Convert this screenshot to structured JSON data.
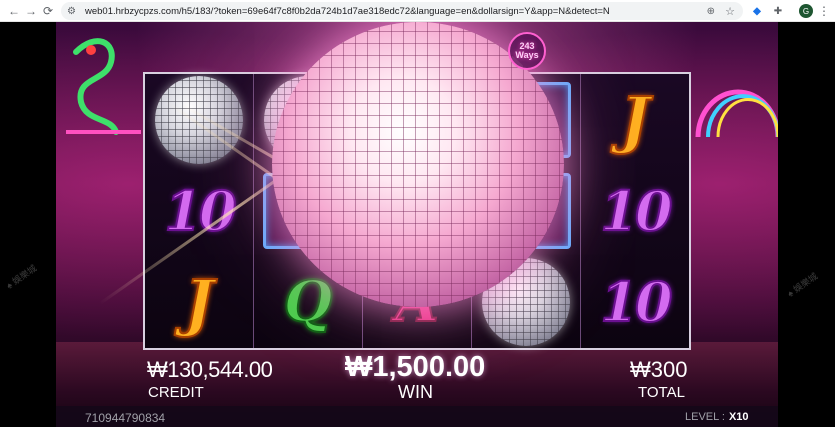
{
  "browser": {
    "url": "web01.hrbzycpzs.com/h5/183/?token=69e64f7c8f0b2da724b1d7ae318edc72&language=en&dollarsign=Y&app=N&detect=N",
    "avatar_letter": "G"
  },
  "game": {
    "ways_number": "243",
    "ways_label": "Ways",
    "reels": [
      [
        "ball",
        "10",
        "J"
      ],
      [
        "ball",
        "frame",
        "Q"
      ],
      [
        "ball",
        "frame",
        "A"
      ],
      [
        "frame",
        "frame",
        "ball"
      ],
      [
        "J",
        "10",
        "10"
      ]
    ]
  },
  "hud": {
    "credit_value": "₩130,544.00",
    "credit_label": "CREDIT",
    "win_value": "₩1,500.00",
    "win_label": "WIN",
    "total_value": "₩300",
    "total_label": "TOTAL",
    "player_id": "710944790834",
    "level_label": "LEVEL :",
    "level_value": "X10",
    "watermark": "♠ 娛樂城"
  },
  "colors": {
    "ten": "#d36bf0",
    "jack": "#ffb020",
    "queen": "#48d04a",
    "ace": "#e83080"
  }
}
